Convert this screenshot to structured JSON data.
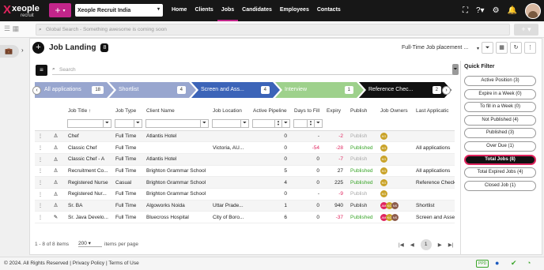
{
  "app": {
    "brand": "xeople",
    "brand_x": "X",
    "sub": "recruit",
    "add_label": "+",
    "org": "Xeople Recruit India"
  },
  "nav": [
    "Home",
    "Clients",
    "Jobs",
    "Candidates",
    "Employees",
    "Contacts"
  ],
  "global_search_placeholder": "Global Search - Something awesome is coming soon",
  "page": {
    "title": "Job Landing",
    "count": "8",
    "view": "Full-Time Job placement ...",
    "search_placeholder": "Search"
  },
  "stages": [
    {
      "label": "All applications",
      "count": "18"
    },
    {
      "label": "Shortlist",
      "count": "4"
    },
    {
      "label": "Screen and Ass...",
      "count": "4"
    },
    {
      "label": "Interview",
      "count": "1"
    },
    {
      "label": "Reference Chec...",
      "count": "2"
    }
  ],
  "columns": [
    "Job Title",
    "Job Type",
    "Client Name",
    "Job Location",
    "Active Pipeline",
    "Days to Fill",
    "Expiry",
    "Publish",
    "Job Owners",
    "Last Applicatic"
  ],
  "rows": [
    {
      "title": "Chef",
      "type": "Full Time",
      "client": "Atlantis Hotel",
      "location": "",
      "pipeline": "0",
      "days": "-",
      "expiry": "-2",
      "publish": "Publish",
      "owners": [
        "KG"
      ],
      "last": ""
    },
    {
      "title": "Classic Chef",
      "type": "Full Time",
      "client": "",
      "location": "Victoria, AU...",
      "pipeline": "0",
      "days": "-54",
      "expiry": "-28",
      "publish": "Published",
      "owners": [
        "KG"
      ],
      "last": "All applications"
    },
    {
      "title": "Classic Chef - A",
      "type": "Full Time",
      "client": "Atlantis Hotel",
      "location": "",
      "pipeline": "0",
      "days": "0",
      "expiry": "-7",
      "publish": "Publish",
      "owners": [
        "KG"
      ],
      "last": ""
    },
    {
      "title": "Recruitment Co...",
      "type": "Full Time",
      "client": "Brighton Grammar School",
      "location": "",
      "pipeline": "5",
      "days": "0",
      "expiry": "27",
      "publish": "Published",
      "owners": [
        "KG"
      ],
      "last": "All applications"
    },
    {
      "title": "Registered Nurse",
      "type": "Casual",
      "client": "Brighton Grammar School",
      "location": "",
      "pipeline": "4",
      "days": "0",
      "expiry": "225",
      "publish": "Published",
      "owners": [
        "KG"
      ],
      "last": "Reference Check"
    },
    {
      "title": "Registered Nur...",
      "type": "Full Time",
      "client": "Brighton Grammar School",
      "location": "",
      "pipeline": "0",
      "days": "-",
      "expiry": "-9",
      "publish": "Publish",
      "owners": [
        "KG"
      ],
      "last": ""
    },
    {
      "title": "Sr. BA",
      "type": "Full Time",
      "client": "Algoworks Noida",
      "location": "Uttar Prade...",
      "pipeline": "1",
      "days": "0",
      "expiry": "940",
      "publish": "Publish",
      "owners": [
        "AM",
        "KG",
        "NS"
      ],
      "last": "Shortlist"
    },
    {
      "title": "Sr. Java Develo...",
      "type": "Full Time",
      "client": "Bluecross Hospital",
      "location": "City of Boro...",
      "pipeline": "6",
      "days": "0",
      "expiry": "-37",
      "publish": "Published",
      "owners": [
        "AM",
        "KG",
        "NS"
      ],
      "last": "Screen and Asse"
    }
  ],
  "pager": {
    "summary": "1 - 8 of 8 items",
    "page_size": "200",
    "per_page_label": "items per page",
    "page": "1",
    "first": "|◀",
    "prev": "◀",
    "next": "▶",
    "last": "▶|"
  },
  "quick_filter": {
    "title": "Quick Filter",
    "items": [
      "Active Position (3)",
      "Expire in a Week (0)",
      "To fill in a Week (0)",
      "Not Published (4)",
      "Published (3)",
      "Over Due (1)",
      "Total Jobs (8)",
      "Total Expired Jobs (4)",
      "Closed Job (1)"
    ],
    "active_index": 6
  },
  "footer": {
    "copyright": "© 2024. All Rights Reserved",
    "sep": "|",
    "privacy": "Privacy Policy",
    "terms": "Terms of Use",
    "ppd": "PPD"
  },
  "colors": {
    "accent": "#c2258a",
    "topbar": "#171717",
    "published": "#3aa52a",
    "negative": "#e0245e"
  }
}
